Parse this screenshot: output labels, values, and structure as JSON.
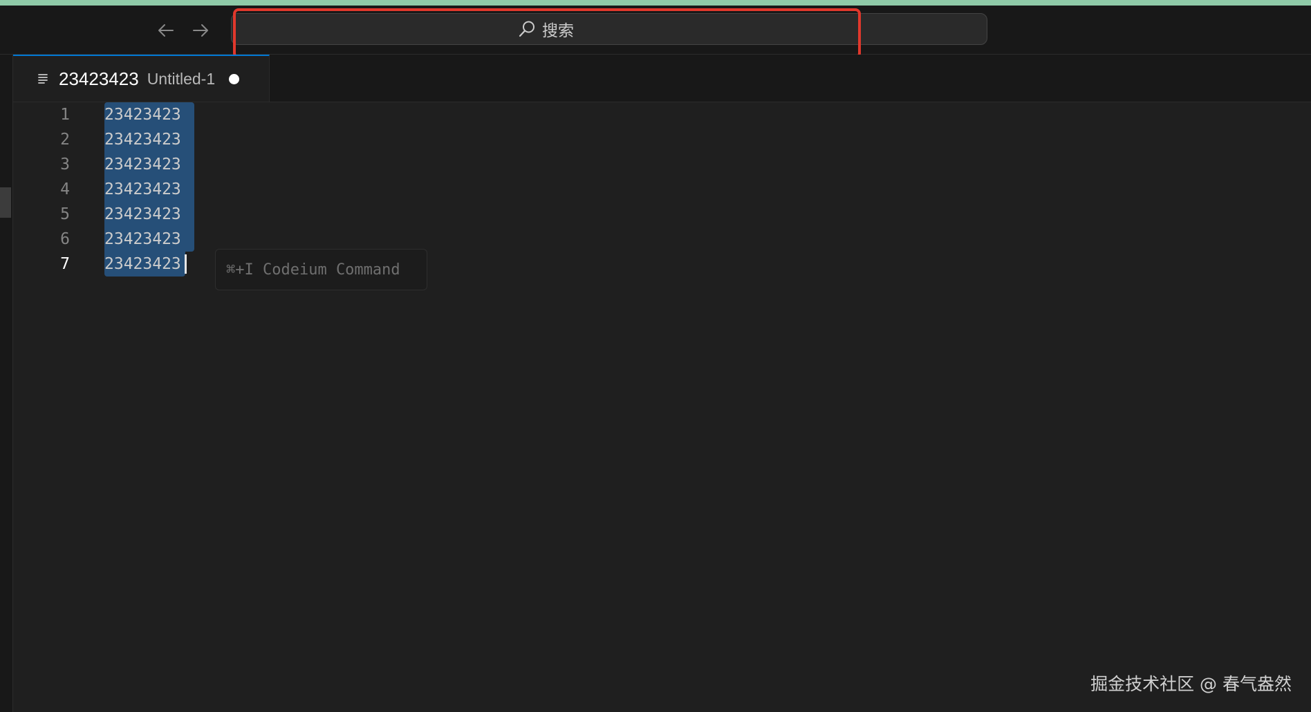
{
  "search": {
    "label": "搜索",
    "icon": "search-icon"
  },
  "nav": {
    "back_icon": "arrow-left-icon",
    "forward_icon": "arrow-right-icon"
  },
  "tab": {
    "name": "23423423",
    "description": "Untitled-1",
    "icon": "lines-icon",
    "dirty": true
  },
  "editor": {
    "lines": [
      {
        "number": "1",
        "text": "23423423"
      },
      {
        "number": "2",
        "text": "23423423"
      },
      {
        "number": "3",
        "text": "23423423"
      },
      {
        "number": "4",
        "text": "23423423"
      },
      {
        "number": "5",
        "text": "23423423"
      },
      {
        "number": "6",
        "text": "23423423"
      },
      {
        "number": "7",
        "text": "23423423"
      }
    ],
    "active_line": "7",
    "inline_hint": "⌘+I Codeium Command"
  },
  "watermark": "掘金技术社区 @ 春气盎然",
  "colors": {
    "accent": "#0078d4",
    "selection": "#264f78",
    "highlight_outline": "#e0382c",
    "top_strip": "#8fcaa8"
  }
}
